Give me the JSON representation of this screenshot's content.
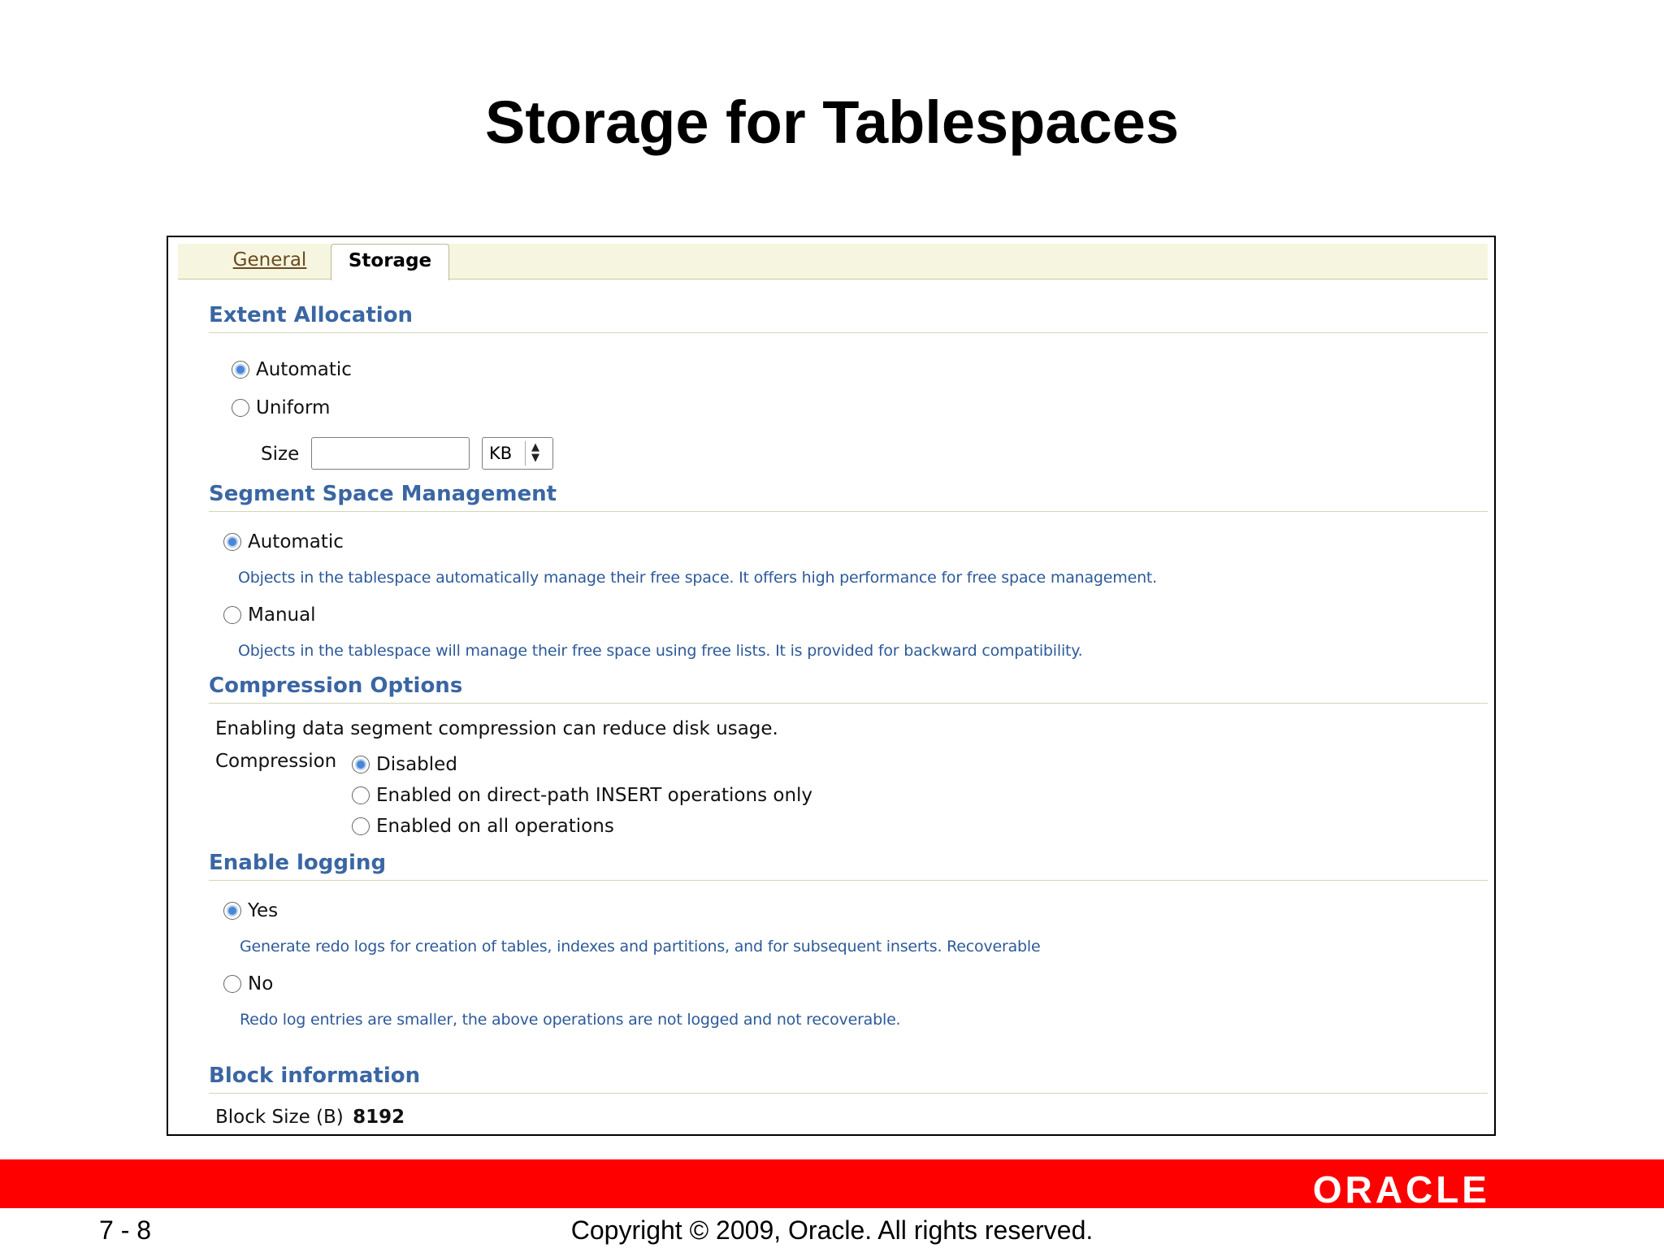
{
  "slide": {
    "title": "Storage for Tablespaces"
  },
  "tabs": [
    {
      "label": "General"
    },
    {
      "label": "Storage"
    }
  ],
  "extent_allocation": {
    "heading": "Extent Allocation",
    "option_automatic": "Automatic",
    "option_uniform": "Uniform",
    "selected": "Automatic",
    "size_label": "Size",
    "size_value": "",
    "unit": "KB"
  },
  "segment_space": {
    "heading": "Segment Space Management",
    "option_automatic": "Automatic",
    "automatic_desc": "Objects in the tablespace automatically manage their free space. It offers high performance for free space management.",
    "option_manual": "Manual",
    "manual_desc": "Objects in the tablespace will manage their free space using free lists. It is provided for backward compatibility.",
    "selected": "Automatic"
  },
  "compression": {
    "heading": "Compression Options",
    "intro": "Enabling data segment compression can reduce disk usage.",
    "label": "Compression",
    "options": [
      "Disabled",
      "Enabled on direct-path INSERT operations only",
      "Enabled on all operations"
    ],
    "selected": "Disabled"
  },
  "logging": {
    "heading": "Enable logging",
    "option_yes": "Yes",
    "yes_desc": "Generate redo logs for creation of tables, indexes and partitions, and for subsequent inserts. Recoverable",
    "option_no": "No",
    "no_desc": "Redo log entries are smaller, the above operations are not logged and not recoverable.",
    "selected": "Yes"
  },
  "block_info": {
    "heading": "Block information",
    "label": "Block Size (B)",
    "value": "8192"
  },
  "footer": {
    "logo_text": "ORACLE",
    "page_number": "7 - 8",
    "copyright": "Copyright © 2009, Oracle. All rights reserved."
  },
  "colors": {
    "section_heading": "#3a66a3",
    "description_text": "#2d5a99",
    "footer_bar": "#ff0000",
    "tab_bar": "#f6f6e0"
  }
}
